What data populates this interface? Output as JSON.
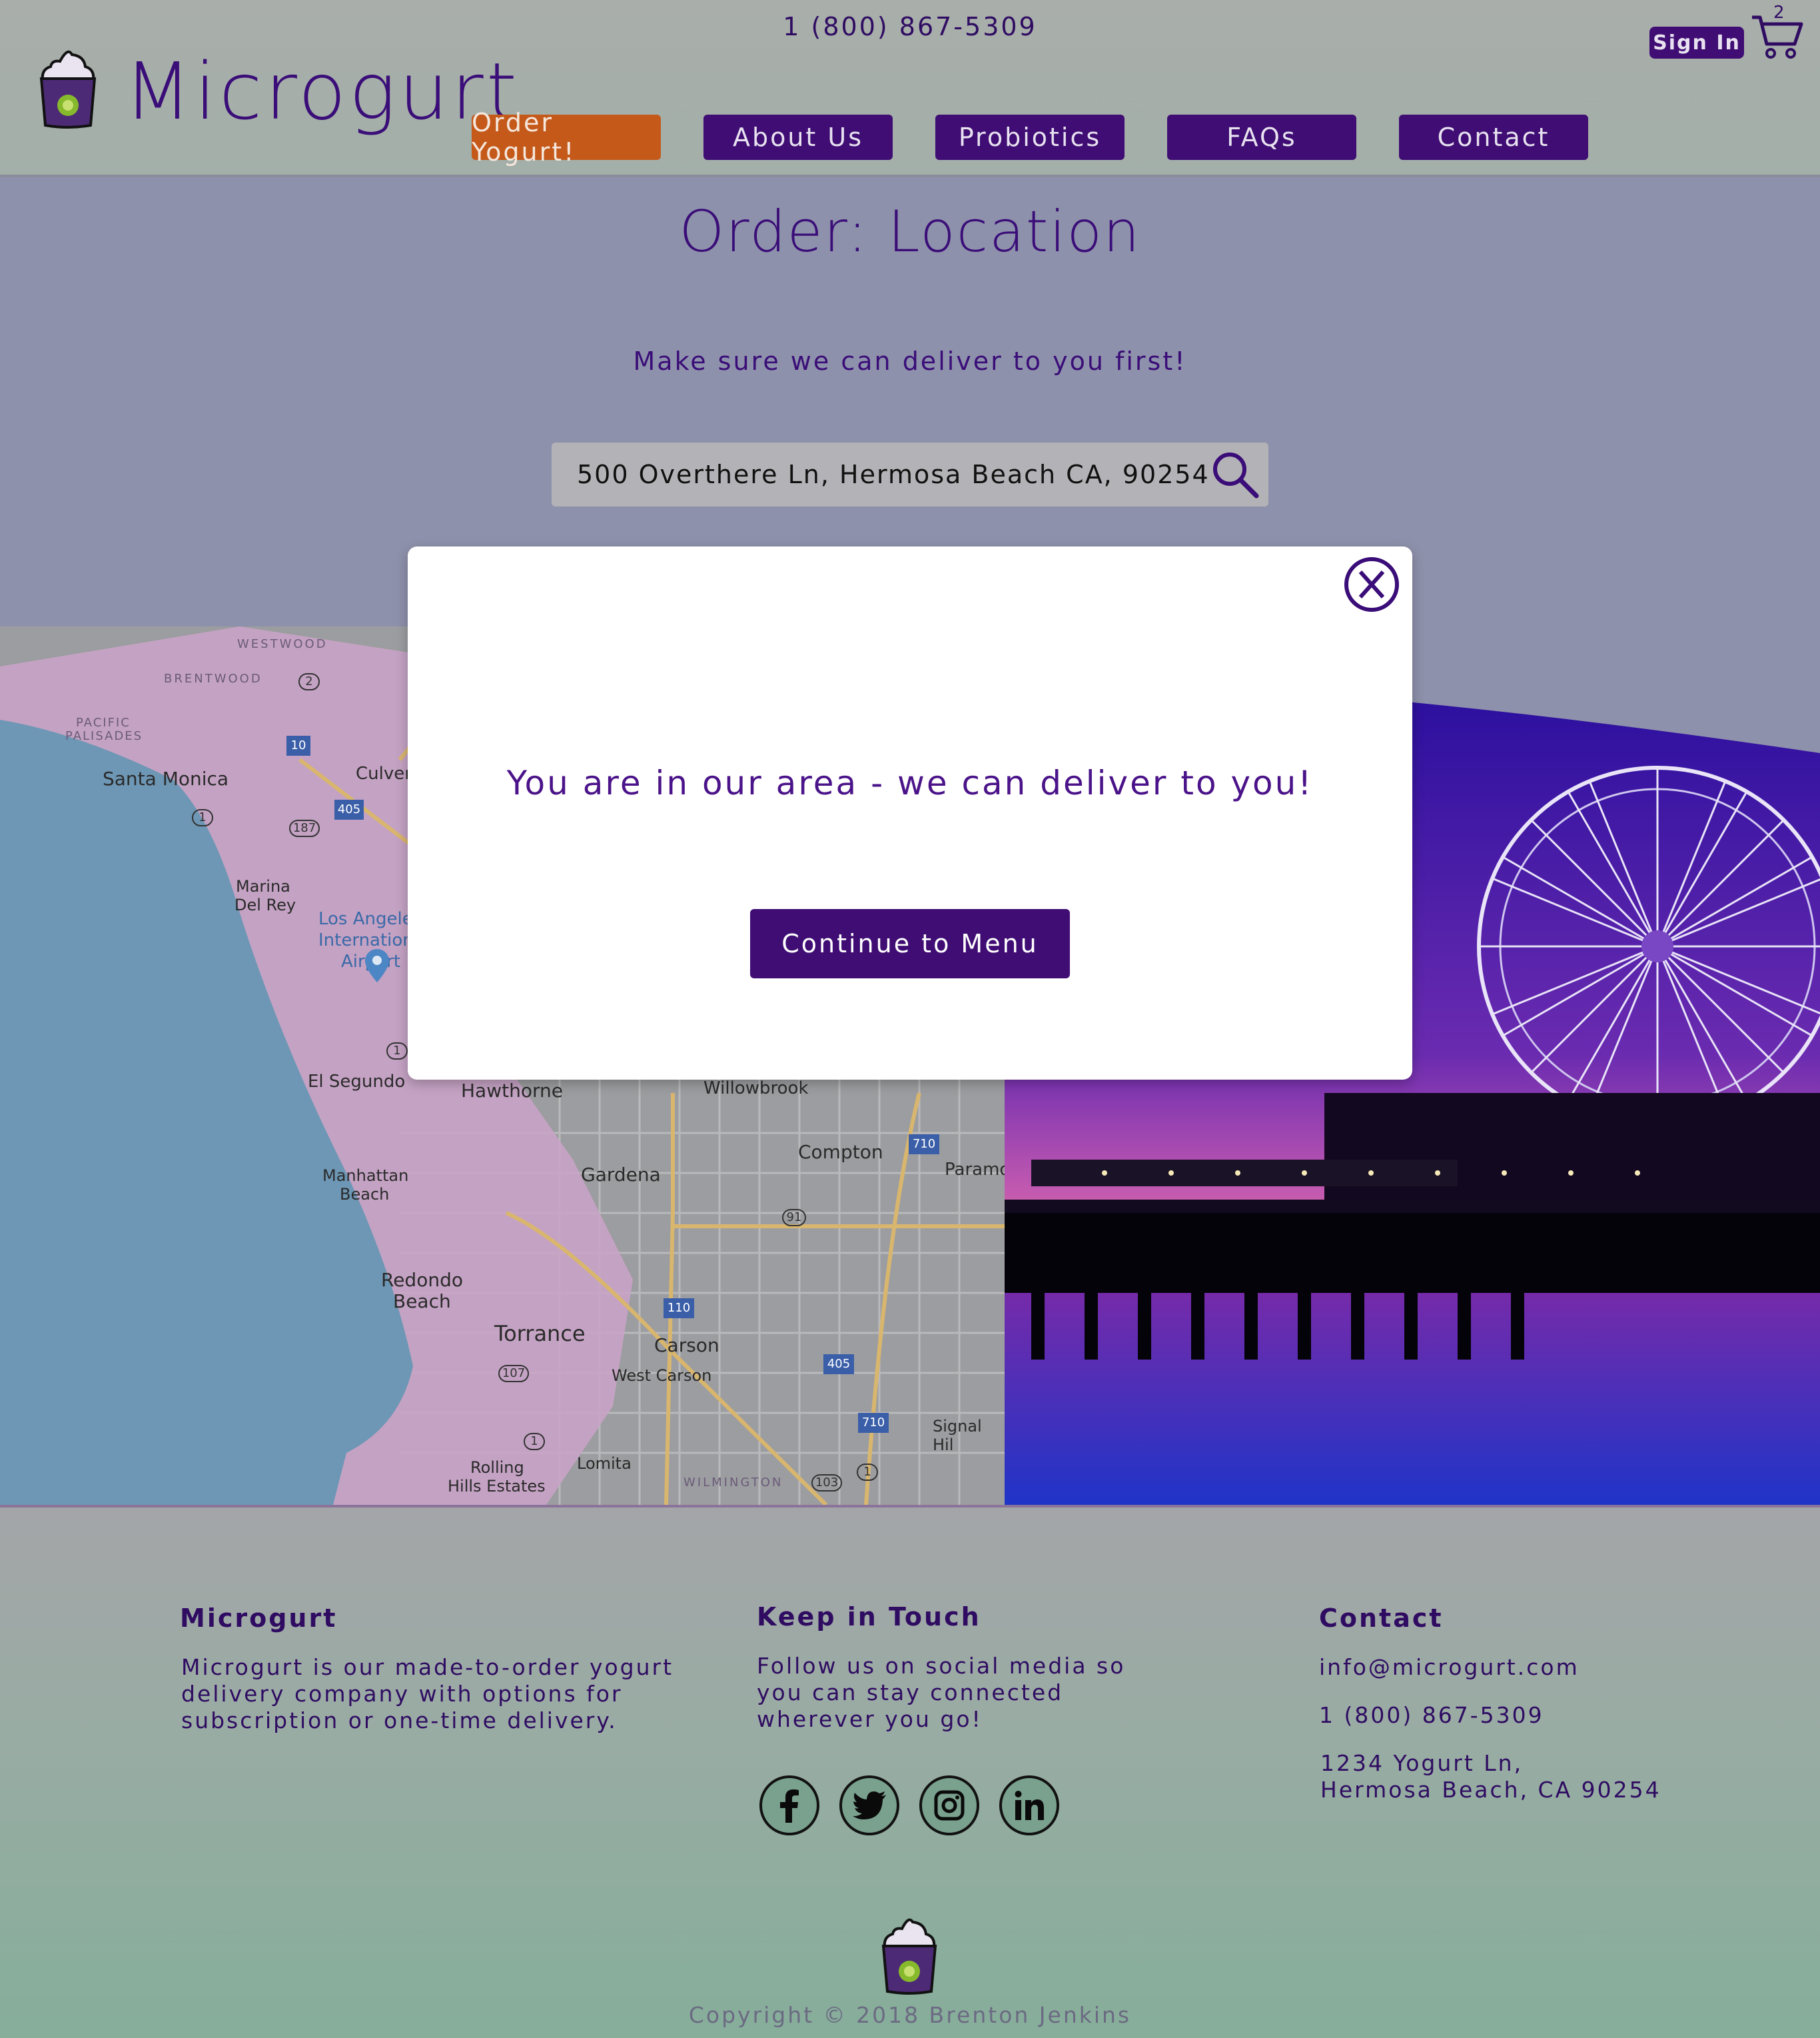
{
  "header": {
    "phone": "1 (800) 867-5309",
    "brand": "Microgurt",
    "sign_in": "Sign In",
    "cart_count": "2",
    "nav": [
      "Order Yogurt!",
      "About Us",
      "Probiotics",
      "FAQs",
      "Contact"
    ]
  },
  "main": {
    "title": "Order: Location",
    "subtitle": "Make sure we can deliver to you first!",
    "search_value": "500 Overthere Ln, Hermosa Beach CA, 90254"
  },
  "map": {
    "labels": [
      "WESTWOOD",
      "BRENTWOOD",
      "PACIFIC",
      "PALISADES",
      "Santa Monica",
      "Culver",
      "Marina",
      "Del Rey",
      "Los Angeles",
      "International",
      "Airport",
      "El Segundo",
      "Hawthorne",
      "Willowbrook",
      "Compton",
      "Paramo",
      "Gardena",
      "Manhattan",
      "Beach",
      "Redondo",
      "Beach",
      "Torrance",
      "Carson",
      "West Carson",
      "Signal Hil",
      "Lomita",
      "Rolling",
      "Hills Estates",
      "WILMINGTON"
    ],
    "shields": [
      "2",
      "10",
      "405",
      "187",
      "1",
      "1",
      "91",
      "110",
      "405",
      "710",
      "107",
      "1",
      "103",
      "1",
      "710"
    ]
  },
  "modal": {
    "message": "You are in our area - we can deliver to you!",
    "button": "Continue to Menu"
  },
  "footer": {
    "col1_title": "Microgurt",
    "col1_text": [
      "Microgurt is our made-to-order yogurt",
      "delivery company with options for",
      "subscription or one-time delivery."
    ],
    "col2_title": "Keep in Touch",
    "col2_text": [
      "Follow us on social media so",
      "you can stay connected",
      "wherever you go!"
    ],
    "social": [
      "facebook-icon",
      "twitter-icon",
      "instagram-icon",
      "linkedin-icon"
    ],
    "col3_title": "Contact",
    "email": "info@microgurt.com",
    "phone": "1 (800) 867-5309",
    "address": [
      "1234 Yogurt Ln,",
      "Hermosa Beach, CA 90254"
    ],
    "copyright": "Copyright © 2018 Brenton Jenkins"
  },
  "colors": {
    "primary": "#3f0d73",
    "accent": "#c4591a",
    "overlay": "#8e91ab"
  }
}
